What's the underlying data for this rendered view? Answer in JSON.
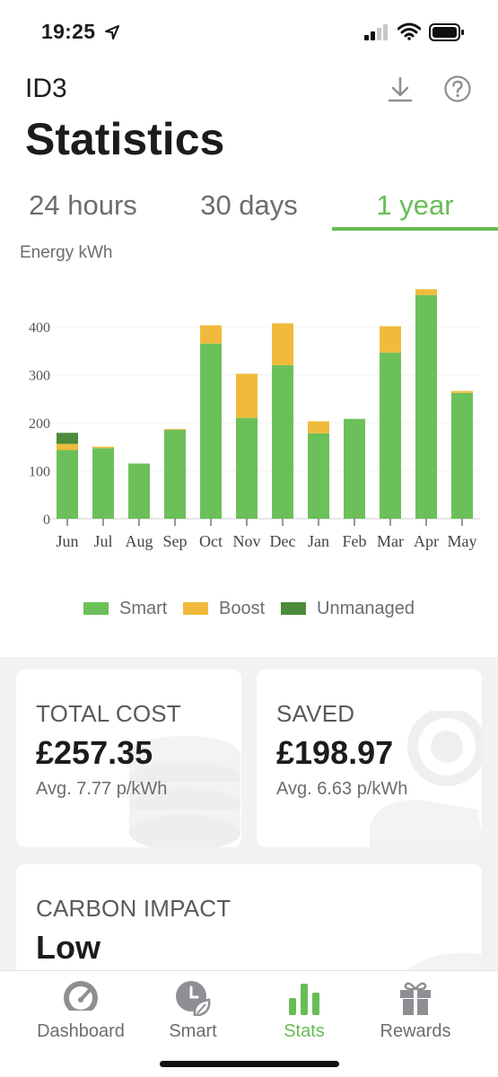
{
  "status_bar": {
    "time": "19:25"
  },
  "header": {
    "device_name": "ID3",
    "title": "Statistics"
  },
  "tabs": [
    {
      "label": "24 hours",
      "active": false
    },
    {
      "label": "30 days",
      "active": false
    },
    {
      "label": "1 year",
      "active": true
    }
  ],
  "colors": {
    "smart": "#6cc05a",
    "boost": "#f0bb3c",
    "unmanaged": "#4b8b3b",
    "accent": "#67bd56"
  },
  "chart_data": {
    "type": "bar",
    "stacked": true,
    "ylabel": "Energy kWh",
    "categories": [
      "Jun",
      "Jul",
      "Aug",
      "Sep",
      "Oct",
      "Nov",
      "Dec",
      "Jan",
      "Feb",
      "Mar",
      "Apr",
      "May"
    ],
    "series": [
      {
        "name": "Smart",
        "values": [
          143,
          147,
          115,
          185,
          365,
          210,
          320,
          178,
          208,
          346,
          466,
          262
        ]
      },
      {
        "name": "Boost",
        "values": [
          13,
          3,
          0,
          2,
          38,
          92,
          87,
          25,
          0,
          55,
          12,
          4
        ]
      },
      {
        "name": "Unmanaged",
        "values": [
          23,
          0,
          0,
          0,
          0,
          0,
          0,
          0,
          0,
          0,
          0,
          0
        ]
      }
    ],
    "yticks": [
      0,
      100,
      200,
      300,
      400
    ],
    "ylim": [
      0,
      480
    ],
    "grid": true,
    "legend_position": "bottom"
  },
  "legend": [
    "Smart",
    "Boost",
    "Unmanaged"
  ],
  "cards": {
    "total_cost": {
      "label": "TOTAL COST",
      "value": "£257.35",
      "sub": "Avg. 7.77 p/kWh"
    },
    "saved": {
      "label": "SAVED",
      "value": "£198.97",
      "sub": "Avg. 6.63 p/kWh"
    },
    "carbon": {
      "label": "CARBON IMPACT",
      "value": "Low"
    }
  },
  "tabbar": [
    {
      "label": "Dashboard",
      "icon": "dashboard-gauge-icon",
      "active": false
    },
    {
      "label": "Smart",
      "icon": "smart-clock-leaf-icon",
      "active": false
    },
    {
      "label": "Stats",
      "icon": "stats-bars-icon",
      "active": true
    },
    {
      "label": "Rewards",
      "icon": "gift-icon",
      "active": false
    }
  ]
}
